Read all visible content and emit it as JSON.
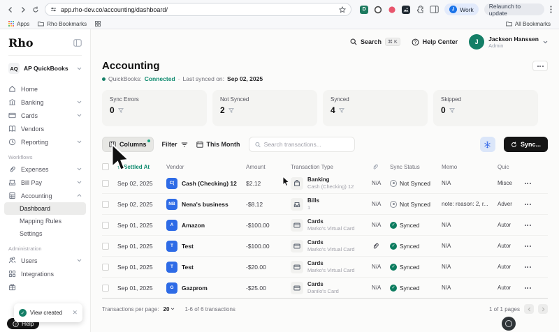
{
  "browser": {
    "url": "app.rho-dev.co/accounting/dashboard/",
    "work_label": "Work",
    "work_initial": "J",
    "relaunch_label": "Relaunch to update",
    "ext_d_label": "D",
    "bookmarks_apps": "Apps",
    "bookmarks_rho": "Rho Bookmarks",
    "bookmarks_all": "All Bookmarks"
  },
  "topbar": {
    "search_label": "Search",
    "search_shortcut": "⌘ K",
    "help_label": "Help Center",
    "user_initial": "J",
    "user_name": "Jackson Hanssen",
    "user_role": "Admin"
  },
  "sidebar": {
    "logo": "Rho",
    "org_initials": "AQ",
    "org_name": "AP QuickBooks",
    "items": [
      {
        "label": "Home"
      },
      {
        "label": "Banking"
      },
      {
        "label": "Cards"
      },
      {
        "label": "Vendors"
      },
      {
        "label": "Reporting"
      }
    ],
    "workflows_label": "Workflows",
    "workflow_items": [
      {
        "label": "Expenses"
      },
      {
        "label": "Bill Pay"
      },
      {
        "label": "Accounting"
      }
    ],
    "accounting_sub": [
      "Dashboard",
      "Mapping Rules",
      "Settings"
    ],
    "admin_label": "Administration",
    "admin_items": [
      {
        "label": "Users"
      },
      {
        "label": "Integrations"
      }
    ],
    "help_label": "Help"
  },
  "toast": {
    "message": "View created"
  },
  "page": {
    "title": "Accounting",
    "qb_label": "QuickBooks:",
    "qb_status": "Connected",
    "sep": "·",
    "synced_label": "Last synced on:",
    "synced_date": "Sep 02, 2025"
  },
  "stats": [
    {
      "label": "Sync Errors",
      "value": "0"
    },
    {
      "label": "Not Synced",
      "value": "2"
    },
    {
      "label": "Synced",
      "value": "4"
    },
    {
      "label": "Skipped",
      "value": "0"
    }
  ],
  "toolbar": {
    "columns_label": "Columns",
    "filter_label": "Filter",
    "month_label": "This Month",
    "search_placeholder": "Search transactions...",
    "sync_label": "Sync..."
  },
  "table": {
    "headers": {
      "settled": "Settled At",
      "vendor": "Vendor",
      "amount": "Amount",
      "type": "Transaction Type",
      "sync": "Sync Status",
      "memo": "Memo",
      "quickbooks": "Quic"
    },
    "rows": [
      {
        "date": "Sep 02, 2025",
        "initials": "C(",
        "vendor": "Cash (Checking) 12",
        "amount": "$2.12",
        "type": "Banking",
        "type_sub": "Cash (Checking) 12",
        "attachment": "N/A",
        "sync": "Not Synced",
        "memo": "N/A",
        "qb": "Misce"
      },
      {
        "date": "Sep 02, 2025",
        "initials": "NB",
        "vendor": "Nena's business",
        "amount": "-$8.12",
        "type": "Bills",
        "type_sub": "1",
        "attachment": "N/A",
        "sync": "Not Synced",
        "memo": "note: reason: 2, r...",
        "qb": "Adver"
      },
      {
        "date": "Sep 01, 2025",
        "initials": "A",
        "vendor": "Amazon",
        "amount": "-$100.00",
        "type": "Cards",
        "type_sub": "Marko's Virtual Card",
        "attachment": "N/A",
        "sync": "Synced",
        "memo": "N/A",
        "qb": "Autor"
      },
      {
        "date": "Sep 01, 2025",
        "initials": "T",
        "vendor": "Test",
        "amount": "-$100.00",
        "type": "Cards",
        "type_sub": "Marko's Virtual Card",
        "attachment": "",
        "sync": "Synced",
        "memo": "N/A",
        "qb": "Autor"
      },
      {
        "date": "Sep 01, 2025",
        "initials": "T",
        "vendor": "Test",
        "amount": "-$20.00",
        "type": "Cards",
        "type_sub": "Marko's Virtual Card",
        "attachment": "N/A",
        "sync": "Synced",
        "memo": "N/A",
        "qb": "Autor"
      },
      {
        "date": "Sep 01, 2025",
        "initials": "G",
        "vendor": "Gazprom",
        "amount": "-$25.00",
        "type": "Cards",
        "type_sub": "Danilo's Card",
        "attachment": "N/A",
        "sync": "Synced",
        "memo": "N/A",
        "qb": "Autor"
      }
    ]
  },
  "footer": {
    "per_page_label": "Transactions per page:",
    "per_page_value": "20",
    "range": "1-6 of 6 transactions",
    "pages": "1 of 1 pages"
  },
  "colors": {
    "accent_green": "#157f67",
    "accent_blue": "#2e6be6",
    "synced_green": "#0c7c5f"
  }
}
